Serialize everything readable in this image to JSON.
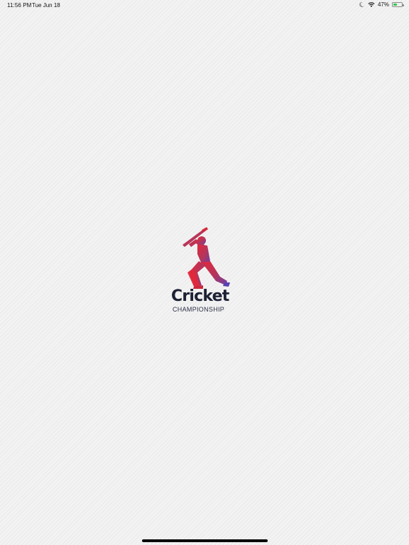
{
  "status_bar": {
    "time": "11:56 PM",
    "date": "Tue Jun 18",
    "battery_text": "47%",
    "battery_level": 0.47,
    "battery_color": "#34c759",
    "icons": [
      "moon-icon",
      "wifi-icon",
      "battery-icon"
    ]
  },
  "logo": {
    "title": "Cricket",
    "subtitle": "CHAMPIONSHIP",
    "figure_icon": "cricket-batsman-icon",
    "gradient_colors": [
      "#e3283a",
      "#b3365c",
      "#6b3fa6"
    ],
    "text_color": "#1d2135"
  }
}
